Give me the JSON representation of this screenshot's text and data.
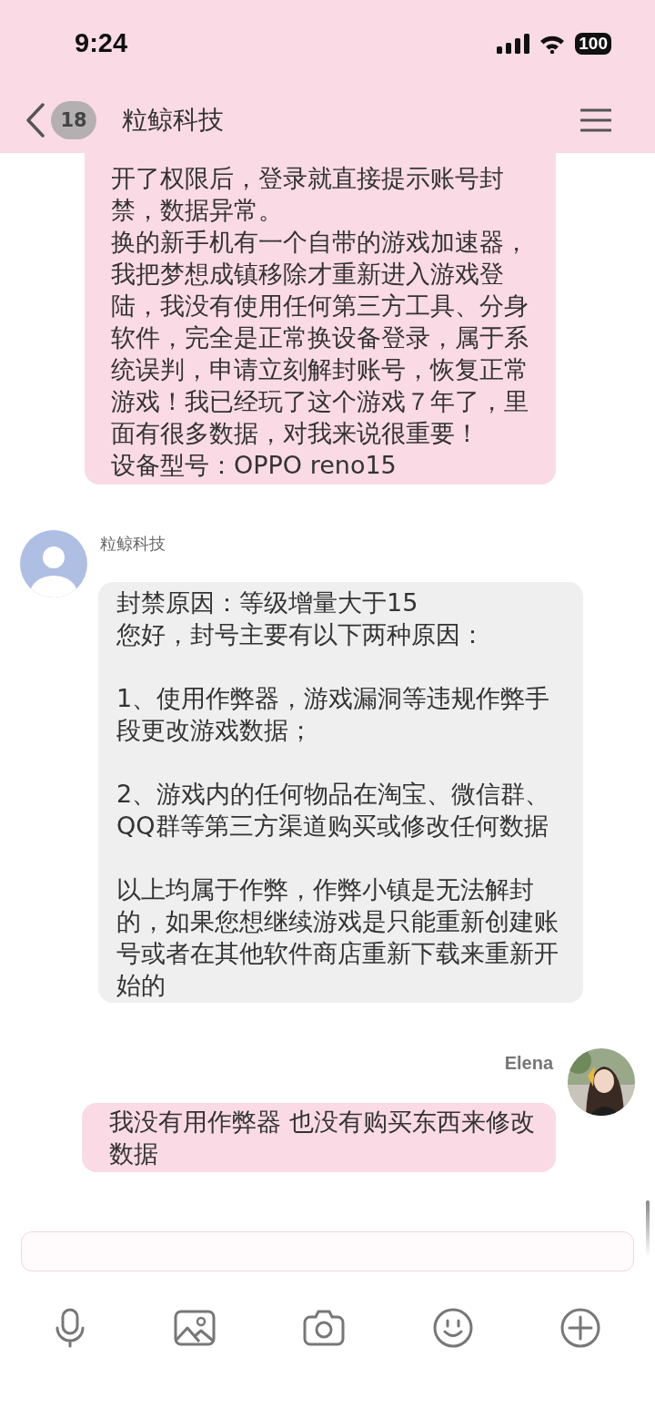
{
  "status_bar": {
    "time": "9:24",
    "battery": "100"
  },
  "header": {
    "back_count": "18",
    "title": "粒鲸科技"
  },
  "messages": [
    {
      "kind": "sent",
      "blocks": [
        [
          "开了权限后，登录就直接提示账号封禁，数据异常。",
          "换的新手机有一个自带的游戏加速器，我把梦想成镇移除才重新进入游戏登陆，我没有使用任何第三方工具、分身软件，完全是正常换设备登录，属于系统误判，申请立刻解封账号，恢复正常游戏！我已经玩了这个游戏７年了，里面有很多数据，对我来说很重要！",
          "设备型号：OPPO reno15"
        ]
      ]
    },
    {
      "kind": "received",
      "sender": "粒鲸科技",
      "blocks": [
        [
          "封禁原因：等级增量大于15",
          "您好，封号主要有以下两种原因："
        ],
        [
          "1、使用作弊器，游戏漏洞等违规作弊手段更改游戏数据；"
        ],
        [
          "2、游戏内的任何物品在淘宝、微信群、QQ群等第三方渠道购买或修改任何数据"
        ],
        [
          "以上均属于作弊，作弊小镇是无法解封的，如果您想继续游戏是只能重新创建账号或者在其他软件商店重新下载来重新开始的"
        ]
      ]
    },
    {
      "kind": "sent",
      "sender": "Elena",
      "blocks": [
        [
          "我没有用作弊器 也没有购买东西来修改数据"
        ]
      ]
    }
  ]
}
